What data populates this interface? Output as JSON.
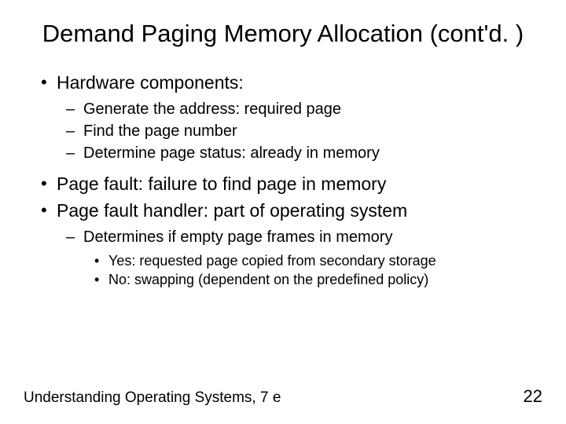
{
  "title": "Demand Paging Memory Allocation (cont'd. )",
  "bullets": {
    "b1": "Hardware components:",
    "b1_1": "Generate the address: required page",
    "b1_2": "Find the page number",
    "b1_3": "Determine page status: already in memory",
    "b2": "Page fault: failure to find page in memory",
    "b3": "Page fault handler: part of operating system",
    "b3_1": "Determines if empty page frames in memory",
    "b3_1_1": "Yes: requested page copied from secondary storage",
    "b3_1_2": "No: swapping (dependent on the predefined policy)"
  },
  "footer": {
    "source": "Understanding Operating Systems, 7 e",
    "page": "22"
  }
}
